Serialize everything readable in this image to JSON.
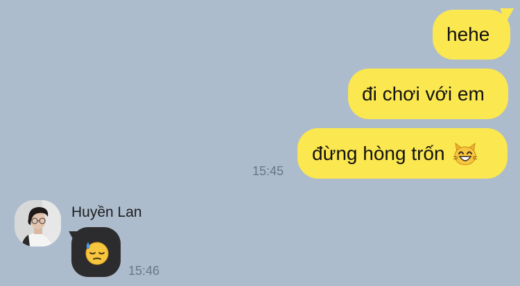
{
  "chat": {
    "sent_messages": [
      {
        "text": "hehe"
      },
      {
        "text": "đi chơi với em"
      },
      {
        "text": "đừng hòng trốn",
        "emoji": "grinning-cat-icon"
      }
    ],
    "sent_time": "15:45",
    "received": {
      "sender_name": "Huyền Lan",
      "avatar": "avatar-photo",
      "emoji": "downcast-sweat-face-icon",
      "time": "15:46"
    }
  },
  "colors": {
    "background": "#adbccd",
    "sent_bubble": "#fbe74f",
    "received_bubble": "#2c2c2e",
    "timestamp": "#6a7685"
  }
}
